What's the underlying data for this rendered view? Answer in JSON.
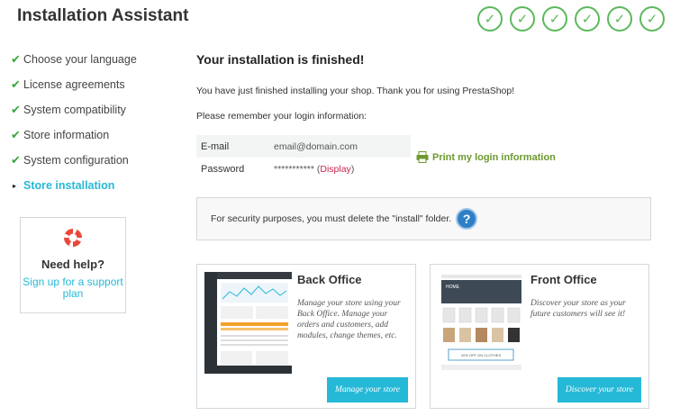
{
  "header": {
    "title": "Installation Assistant",
    "steps_completed": 6,
    "step_check": "✓"
  },
  "sidebar": {
    "items": [
      {
        "label": "Choose your language",
        "state": "done"
      },
      {
        "label": "License agreements",
        "state": "done"
      },
      {
        "label": "System compatibility",
        "state": "done"
      },
      {
        "label": "Store information",
        "state": "done"
      },
      {
        "label": "System configuration",
        "state": "done"
      },
      {
        "label": "Store installation",
        "state": "active"
      }
    ],
    "check_glyph": "✔",
    "bullet_glyph": "▸"
  },
  "help": {
    "title": "Need help?",
    "link": "Sign up for a support plan"
  },
  "main": {
    "title": "Your installation is finished!",
    "text1": "You have just finished installing your shop. Thank you for using PrestaShop!",
    "text2": "Please remember your login information:"
  },
  "login": {
    "email_label": "E-mail",
    "email_value": "email@domain.com",
    "password_label": "Password",
    "password_value": "***********",
    "display_link": "Display",
    "print_label": "Print my login information"
  },
  "security": {
    "text": "For security purposes, you must delete the \"install\" folder.",
    "help_glyph": "?"
  },
  "cards": {
    "back_office": {
      "title": "Back Office",
      "description": "Manage your store using your Back Office. Manage your orders and customers, add modules, change themes, etc.",
      "button": "Manage your store"
    },
    "front_office": {
      "title": "Front Office",
      "description": "Discover your store as your future customers will see it!",
      "button": "Discover your store",
      "thumb_banner": "HOME",
      "thumb_promo": "20% OFF ON CLOTHES"
    }
  },
  "colors": {
    "accent": "#25b9d7",
    "success": "#5cb85c",
    "print_green": "#6b9a2e",
    "display_link": "#c7254e",
    "help_blue": "#2e80c6"
  }
}
